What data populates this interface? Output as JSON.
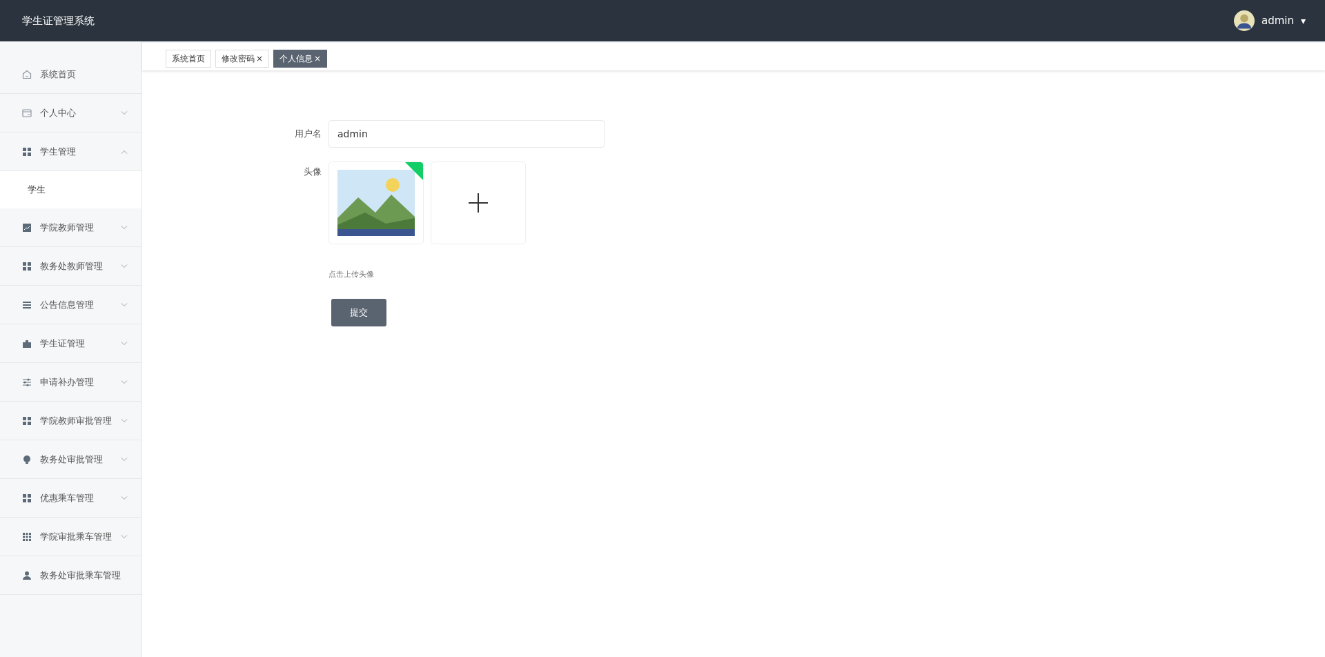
{
  "header": {
    "title": "学生证管理系统",
    "user": "admin",
    "user_menu_caret": "▾"
  },
  "sidebar": {
    "items": [
      {
        "label": "系统首页",
        "has_children": false,
        "expanded": false
      },
      {
        "label": "个人中心",
        "has_children": true,
        "expanded": false
      },
      {
        "label": "学生管理",
        "has_children": true,
        "expanded": true,
        "children": [
          {
            "label": "学生",
            "selected": true
          }
        ]
      },
      {
        "label": "学院教师管理",
        "has_children": true,
        "expanded": false
      },
      {
        "label": "教务处教师管理",
        "has_children": true,
        "expanded": false
      },
      {
        "label": "公告信息管理",
        "has_children": true,
        "expanded": false
      },
      {
        "label": "学生证管理",
        "has_children": true,
        "expanded": false
      },
      {
        "label": "申请补办管理",
        "has_children": true,
        "expanded": false
      },
      {
        "label": "学院教师审批管理",
        "has_children": true,
        "expanded": false
      },
      {
        "label": "教务处审批管理",
        "has_children": true,
        "expanded": false
      },
      {
        "label": "优惠乘车管理",
        "has_children": true,
        "expanded": false
      },
      {
        "label": "学院审批乘车管理",
        "has_children": true,
        "expanded": false
      },
      {
        "label": "教务处审批乘车管理",
        "has_children": false,
        "expanded": false
      }
    ]
  },
  "tabs": [
    {
      "label": "系统首页",
      "selected": false
    },
    {
      "label": "修改密码",
      "close_mark": "×",
      "selected": false
    },
    {
      "label": "个人信息",
      "close_mark": "×",
      "selected": true
    }
  ],
  "form": {
    "username_label": "用户名",
    "username_value": "admin",
    "avatar_label": "头像",
    "upload_hint": "点击上传头像",
    "submit": "提交"
  }
}
